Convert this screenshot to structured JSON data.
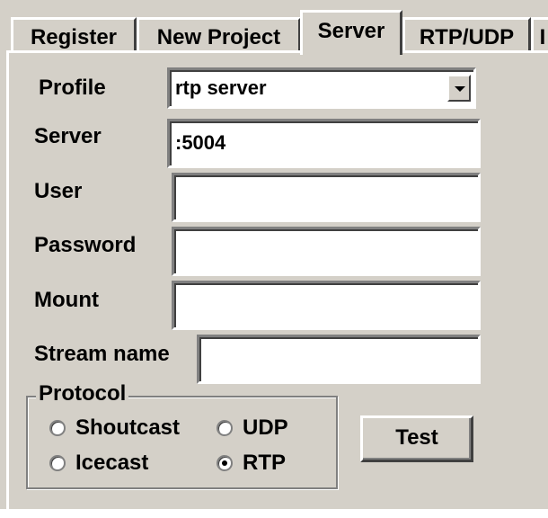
{
  "tabs": [
    {
      "label": "Register"
    },
    {
      "label": "New Project"
    },
    {
      "label": "Server",
      "active": true
    },
    {
      "label": "RTP/UDP"
    },
    {
      "label": "I"
    }
  ],
  "form": {
    "profile": {
      "label": "Profile",
      "value": "rtp server"
    },
    "server": {
      "label": "Server",
      "value": ":5004"
    },
    "user": {
      "label": "User",
      "value": ""
    },
    "password": {
      "label": "Password",
      "value": ""
    },
    "mount": {
      "label": "Mount",
      "value": ""
    },
    "stream_name": {
      "label": "Stream name",
      "value": ""
    }
  },
  "protocol": {
    "title": "Protocol",
    "options": [
      {
        "label": "Shoutcast",
        "checked": false
      },
      {
        "label": "UDP",
        "checked": false
      },
      {
        "label": "Icecast",
        "checked": false
      },
      {
        "label": "RTP",
        "checked": true
      }
    ]
  },
  "test_button": {
    "label": "Test"
  },
  "colors": {
    "face": "#d4d0c8",
    "field": "#ffffff",
    "shadow": "#808080",
    "dark": "#404040"
  },
  "icons": {
    "combo": "chevron-down-icon",
    "radio": "radio-icon"
  }
}
